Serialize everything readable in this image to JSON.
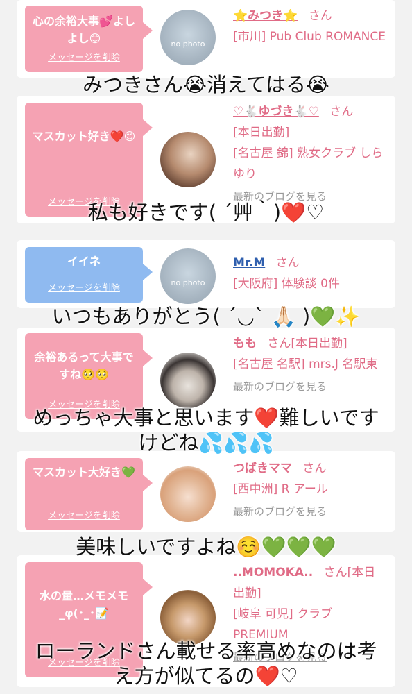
{
  "cards": [
    {
      "bubble_text": "心の余裕大事💕よしよし😊",
      "delete_label": "メッセージを削除",
      "avatar_text": "no photo",
      "name": "⭐みつき⭐",
      "honorific": "さん",
      "lines": [
        "[市川] Pub Club ROMANCE"
      ]
    },
    {
      "bubble_text": "マスカット好き❤️😊",
      "delete_label": "メッセージを削除",
      "name": "♡🐇ゆづき🐇♡",
      "honorific": "さん",
      "lines": [
        "[本日出勤]",
        "[名古屋 錦] 熟女クラブ しらゆり"
      ],
      "blog": "最新のブログを見る"
    },
    {
      "bubble_text": "イイネ",
      "delete_label": "メッセージを削除",
      "avatar_text": "no photo",
      "name": "Mr.M",
      "honorific": "さん",
      "lines": [
        "[大阪府] 体験談 0件"
      ]
    },
    {
      "bubble_text": "余裕あるって大事ですね🥺🥺",
      "delete_label": "メッセージを削除",
      "name": "もも",
      "honorific": "さん[本日出勤]",
      "lines": [
        "[名古屋 名駅] mrs.J 名駅東"
      ],
      "blog": "最新のブログを見る"
    },
    {
      "bubble_text": "マスカット大好き💚",
      "delete_label": "メッセージを削除",
      "name": "つばきママ",
      "honorific": "さん",
      "lines": [
        "[西中洲] R アール"
      ],
      "blog": "最新のブログを見る"
    },
    {
      "bubble_text": "水の量…メモメモ_φ(･_･📝",
      "delete_label": "メッセージを削除",
      "name": "..MOMOKA..",
      "honorific": "さん[本日出勤]",
      "lines": [
        "[岐阜 可児] クラブ PREMIUM"
      ],
      "blog": "最新のブログを見る"
    }
  ],
  "captions": {
    "c1": "みつきさん😭消えてはる😭",
    "c2_text": "私も好きです( ´艸｀)",
    "c2_hearts": [
      "❤️",
      "♡"
    ],
    "c3_text": "いつもありがとう( ´◡` 🙏🏻 )",
    "c3_heart": "💚✨",
    "c4_line1": "めっちゃ大事と思います",
    "c4_heart": "❤️",
    "c4_line1b": "難しいです",
    "c4_line2": "けどね💦💦💦",
    "c5_text": "美味しいですよね☺️",
    "c5_hearts": "💚💚💚",
    "c6_line1": "ローランドさん載せる率高めなのは考",
    "c6_line2": "え方が似てるの",
    "c6_hearts": [
      "❤️",
      "♡"
    ]
  },
  "colors": {
    "bubble_pink": "#f5a2b3",
    "bubble_blue": "#8fbaf0",
    "name_pink": "#e06b86",
    "name_blue": "#2f5fae"
  }
}
